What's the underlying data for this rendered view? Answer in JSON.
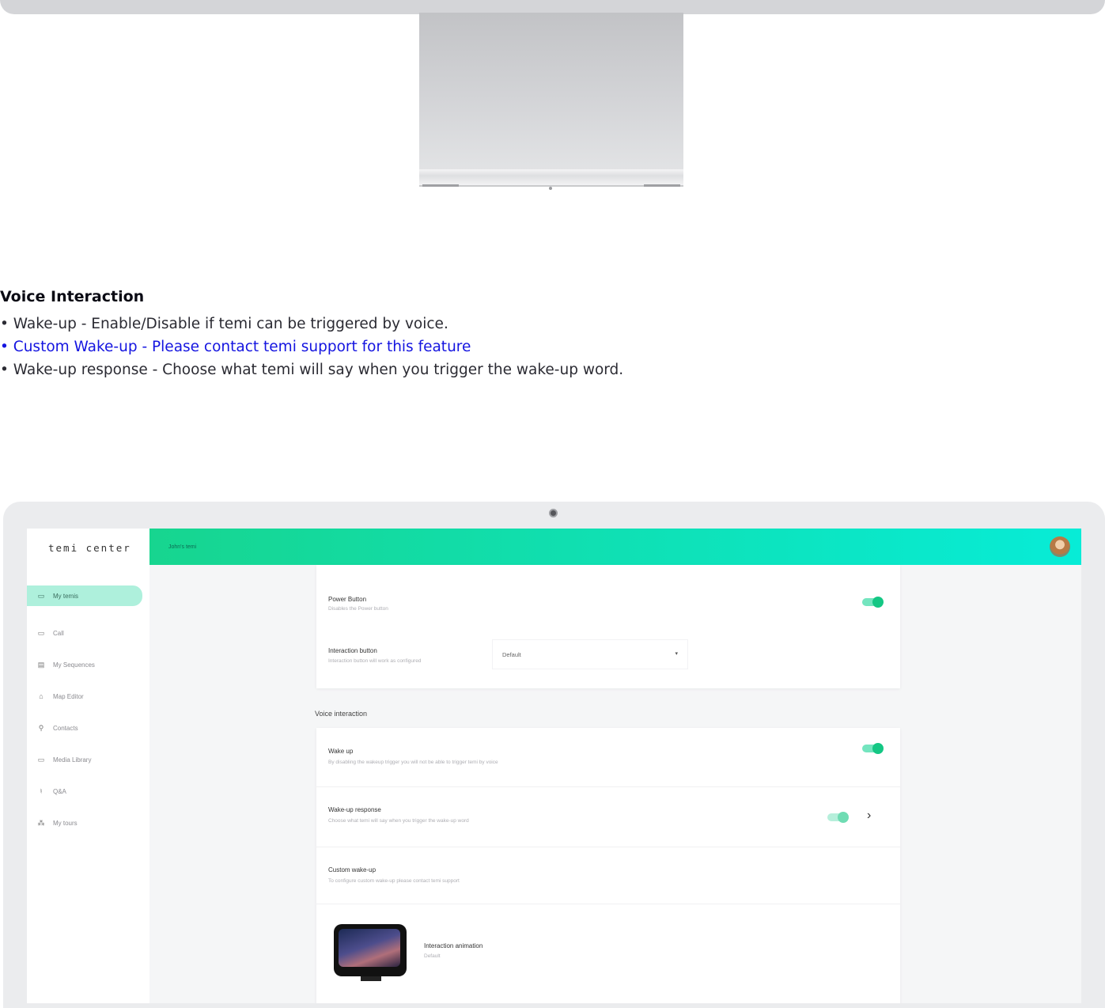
{
  "description": {
    "heading": "Voice Interaction",
    "bullets": [
      "• Wake-up - Enable/Disable if temi can be triggered by voice.",
      "• Custom Wake-up - Please contact temi support for this feature",
      "• Wake-up response - Choose what temi will say when you trigger the wake-up word."
    ]
  },
  "app": {
    "logo": "temi center",
    "robot_name": "John's temi"
  },
  "sidebar": {
    "items": [
      {
        "label": "My temis",
        "icon": "robot-icon",
        "glyph": "▭",
        "active": true
      },
      {
        "label": "Call",
        "icon": "video-call-icon",
        "glyph": "▭",
        "active": false
      },
      {
        "label": "My Sequences",
        "icon": "sequences-icon",
        "glyph": "▤",
        "active": false
      },
      {
        "label": "Map Editor",
        "icon": "map-editor-icon",
        "glyph": "⌂",
        "active": false
      },
      {
        "label": "Contacts",
        "icon": "contacts-icon",
        "glyph": "⚲",
        "active": false
      },
      {
        "label": "Media Library",
        "icon": "folder-icon",
        "glyph": "▭",
        "active": false
      },
      {
        "label": "Q&A",
        "icon": "microphone-icon",
        "glyph": "♮",
        "active": false
      },
      {
        "label": "My tours",
        "icon": "tours-icon",
        "glyph": "⁂",
        "active": false
      }
    ]
  },
  "settings": {
    "power_button": {
      "title": "Power Button",
      "subtitle": "Disables the Power button",
      "enabled": true
    },
    "interaction_button": {
      "title": "Interaction button",
      "subtitle": "Interaction button will work as configured",
      "value": "Default"
    },
    "voice_section_title": "Voice interaction",
    "wake_up": {
      "title": "Wake up",
      "subtitle": "By disabling the wakeup trigger you will not be able to trigger temi by voice",
      "enabled": true
    },
    "wake_up_response": {
      "title": "Wake-up response",
      "subtitle": "Choose what temi will say when you trigger the wake-up word",
      "enabled": true
    },
    "custom_wake_up": {
      "title": "Custom wake-up",
      "subtitle": "To configure custom wake-up please contact temi support"
    },
    "interaction_animation": {
      "title": "Interaction animation",
      "value": "Default"
    }
  },
  "colors": {
    "accent": "#14c784",
    "topbar_start": "#17d58f",
    "topbar_end": "#07ecd7",
    "link_blue": "#1414e0"
  }
}
